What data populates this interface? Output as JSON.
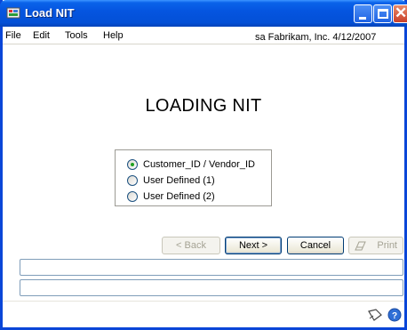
{
  "window": {
    "title": "Load NIT",
    "controls": {
      "minimize": "minimize-icon",
      "maximize": "maximize-icon",
      "close": "close-icon"
    }
  },
  "menu": {
    "items": [
      {
        "label": "File",
        "mnemonic": "F"
      },
      {
        "label": "Edit",
        "mnemonic": "E"
      },
      {
        "label": "Tools",
        "mnemonic": "T"
      },
      {
        "label": "Help",
        "mnemonic": "H"
      }
    ],
    "status": "sa  Fabrikam, Inc.  4/12/2007"
  },
  "main": {
    "heading": "LOADING NIT",
    "options": [
      {
        "label": "Customer_ID / Vendor_ID",
        "selected": true
      },
      {
        "label": "User Defined (1)",
        "selected": false
      },
      {
        "label": "User Defined (2)",
        "selected": false
      }
    ]
  },
  "buttons": {
    "back": "< Back",
    "next": "Next >",
    "cancel": "Cancel",
    "print": "Print"
  },
  "status_fields": [
    "",
    ""
  ],
  "footer": {
    "icons": [
      "note-icon",
      "help-icon"
    ]
  },
  "colors": {
    "title_bar": "#0555e0",
    "window_border": "#0a46d8",
    "radio_check": "#21a121"
  }
}
